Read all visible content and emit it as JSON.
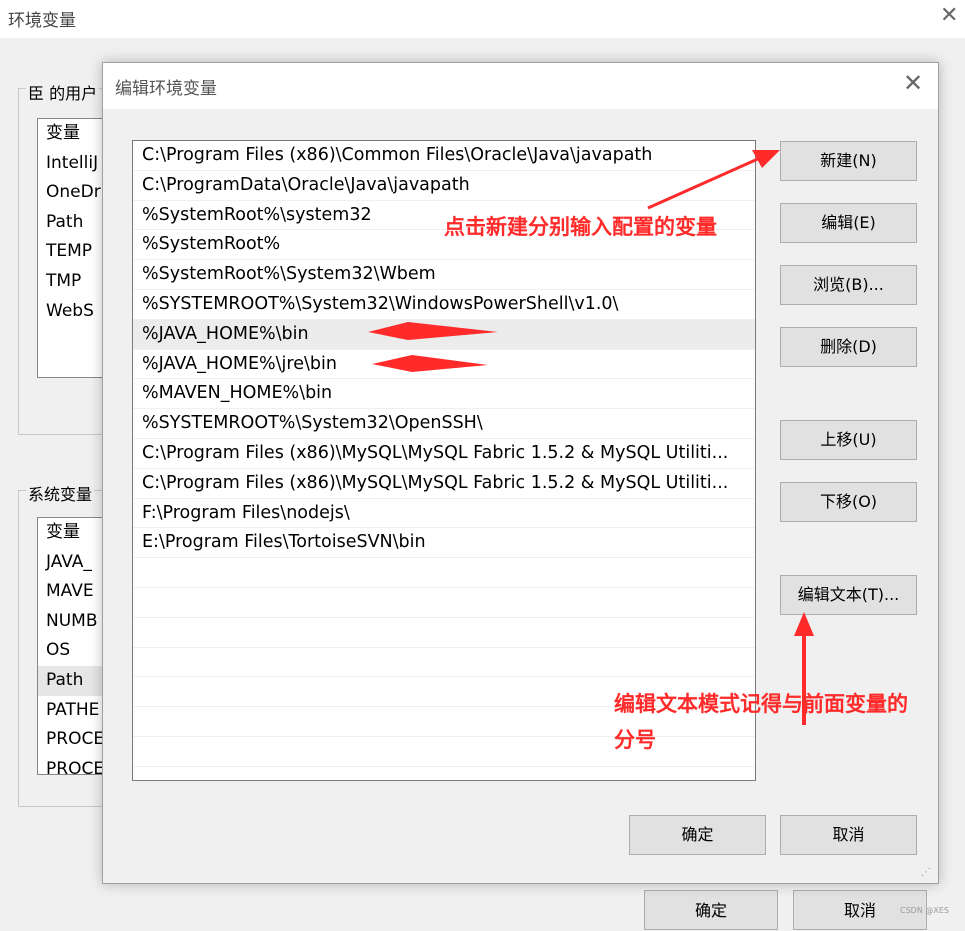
{
  "outer": {
    "title": "环境变量",
    "user_group_label": "臣 的用户",
    "user_list": [
      "变量",
      "IntelliJ",
      "OneDr",
      "Path",
      "TEMP",
      "TMP",
      "WebS"
    ],
    "system_group_label": "系统变量",
    "system_list": [
      "变量",
      "JAVA_",
      "MAVE",
      "NUMB",
      "OS",
      "Path",
      "PATHE",
      "PROCE",
      "PROCE"
    ],
    "ok_label": "确定",
    "cancel_label": "取消"
  },
  "dialog": {
    "title": "编辑环境变量",
    "paths": [
      "C:\\Program Files (x86)\\Common Files\\Oracle\\Java\\javapath",
      "C:\\ProgramData\\Oracle\\Java\\javapath",
      "%SystemRoot%\\system32",
      "%SystemRoot%",
      "%SystemRoot%\\System32\\Wbem",
      "%SYSTEMROOT%\\System32\\WindowsPowerShell\\v1.0\\",
      "%JAVA_HOME%\\bin",
      "%JAVA_HOME%\\jre\\bin",
      "%MAVEN_HOME%\\bin",
      "%SYSTEMROOT%\\System32\\OpenSSH\\",
      "C:\\Program Files (x86)\\MySQL\\MySQL Fabric 1.5.2 & MySQL Utiliti...",
      "C:\\Program Files (x86)\\MySQL\\MySQL Fabric 1.5.2 & MySQL Utiliti...",
      "F:\\Program Files\\nodejs\\",
      "E:\\Program Files\\TortoiseSVN\\bin"
    ],
    "buttons": {
      "new": "新建(N)",
      "edit": "编辑(E)",
      "browse": "浏览(B)...",
      "delete": "删除(D)",
      "move_up": "上移(U)",
      "move_down": "下移(O)",
      "edit_text": "编辑文本(T)...",
      "ok": "确定",
      "cancel": "取消"
    }
  },
  "annotations": {
    "new_hint": "点击新建分别输入配置的变量",
    "edit_text_hint_line1": "编辑文本模式记得与前面变量的",
    "edit_text_hint_line2": "分号"
  },
  "watermark": "CSDN @XES",
  "colors": {
    "annotation": "#ff2b2b",
    "highlight_row": "#ececec"
  }
}
